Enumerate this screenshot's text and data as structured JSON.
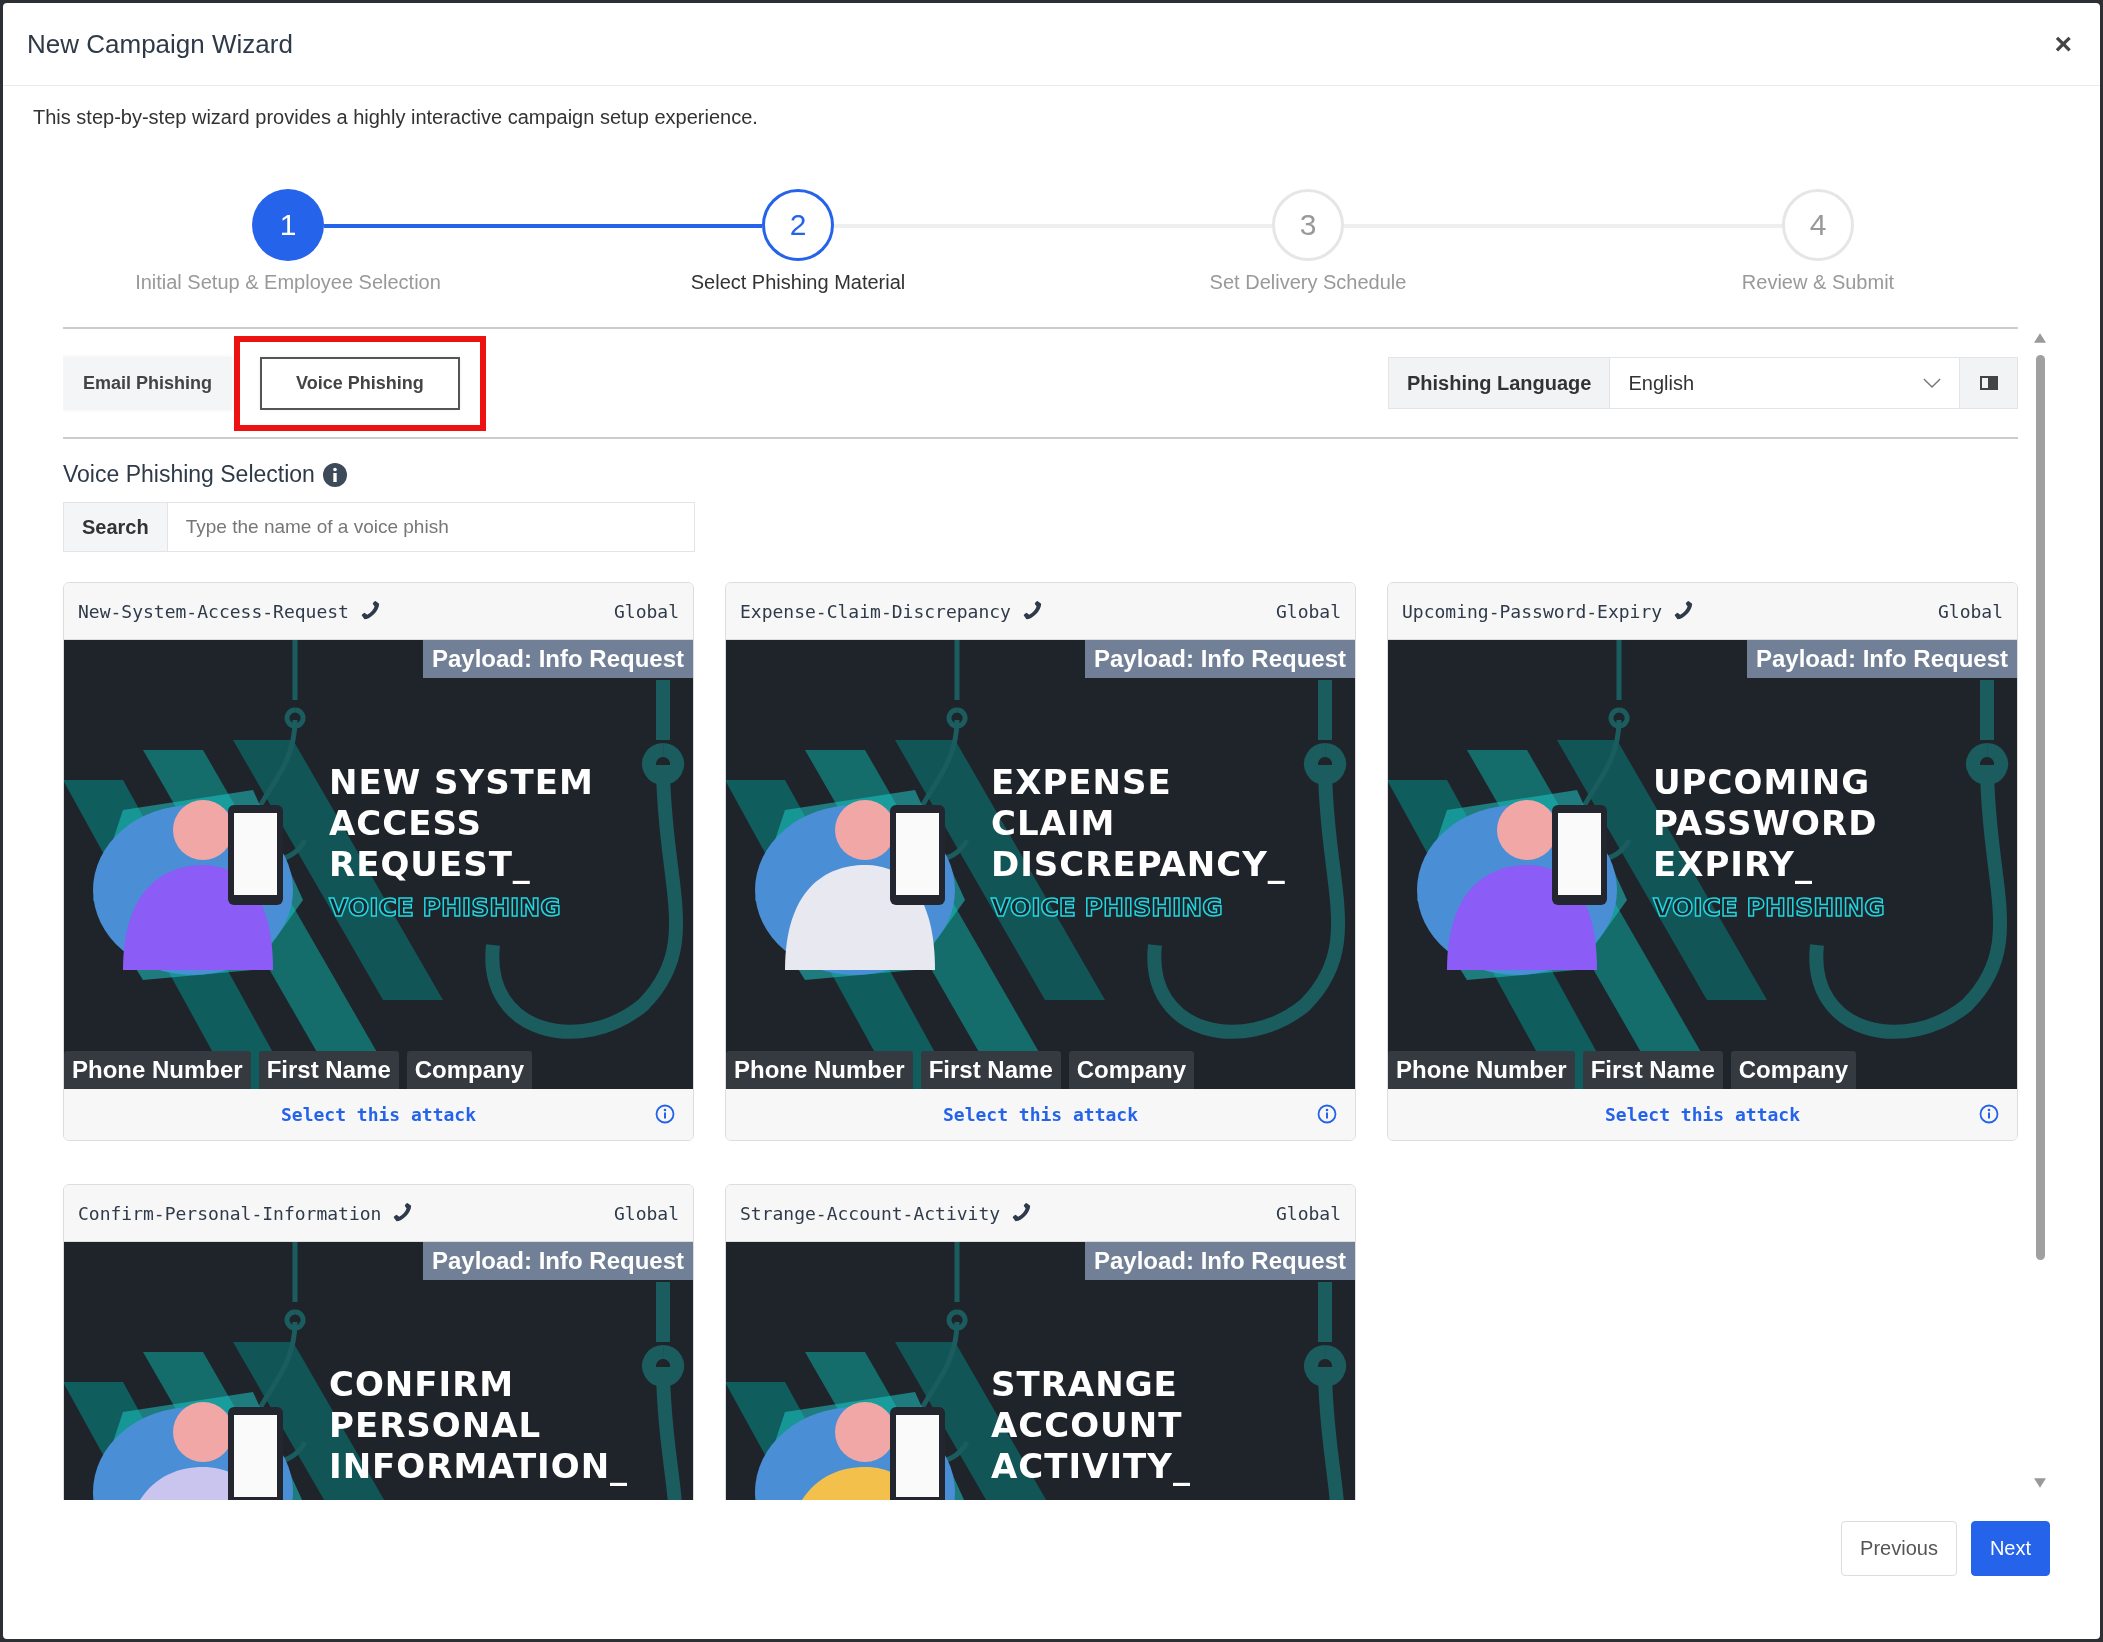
{
  "window": {
    "title": "New Campaign Wizard",
    "close": "×"
  },
  "description": "This step-by-step wizard provides a highly interactive campaign setup experience.",
  "steps": [
    {
      "number": "1",
      "label": "Initial Setup & Employee Selection",
      "completed": true,
      "selected": false
    },
    {
      "number": "2",
      "label": "Select Phishing Material",
      "completed": false,
      "selected": true
    },
    {
      "number": "3",
      "label": "Set Delivery Schedule",
      "completed": false,
      "selected": false
    },
    {
      "number": "4",
      "label": "Review & Submit",
      "completed": false,
      "selected": false
    }
  ],
  "tabs": [
    {
      "label": "Email Phishing",
      "selected": false,
      "highlighted": false
    },
    {
      "label": "Voice Phishing",
      "selected": true,
      "highlighted": true
    }
  ],
  "language": {
    "label": "Phishing Language",
    "value": "English"
  },
  "section_title": "Voice Phishing Selection",
  "search": {
    "label": "Search",
    "placeholder": "Type the name of a voice phish"
  },
  "cards": [
    {
      "title": "New-System-Access-Request",
      "scope": "Global",
      "payload": "Payload: Info Request",
      "banner_lines": [
        "NEW SYSTEM",
        "ACCESS",
        "REQUEST_"
      ],
      "banner_subtitle": "VOICE PHISHING",
      "tags": [
        "Phone Number",
        "First Name",
        "Company"
      ],
      "action": "Select this attack"
    },
    {
      "title": "Expense-Claim-Discrepancy",
      "scope": "Global",
      "payload": "Payload: Info Request",
      "banner_lines": [
        "EXPENSE",
        "CLAIM",
        "DISCREPANCY_"
      ],
      "banner_subtitle": "VOICE PHISHING",
      "tags": [
        "Phone Number",
        "First Name",
        "Company"
      ],
      "action": "Select this attack"
    },
    {
      "title": "Upcoming-Password-Expiry",
      "scope": "Global",
      "payload": "Payload: Info Request",
      "banner_lines": [
        "UPCOMING",
        "PASSWORD",
        "EXPIRY_"
      ],
      "banner_subtitle": "VOICE PHISHING",
      "tags": [
        "Phone Number",
        "First Name",
        "Company"
      ],
      "action": "Select this attack"
    },
    {
      "title": "Confirm-Personal-Information",
      "scope": "Global",
      "payload": "Payload: Info Request",
      "banner_lines": [
        "CONFIRM",
        "PERSONAL",
        "INFORMATION_"
      ]
    },
    {
      "title": "Strange-Account-Activity",
      "scope": "Global",
      "payload": "Payload: Info Request",
      "banner_lines": [
        "STRANGE",
        "ACCOUNT",
        "ACTIVITY_"
      ]
    }
  ],
  "buttons": [
    {
      "label": "Previous",
      "kind": "secondary"
    },
    {
      "label": "Next",
      "kind": "primary"
    }
  ]
}
